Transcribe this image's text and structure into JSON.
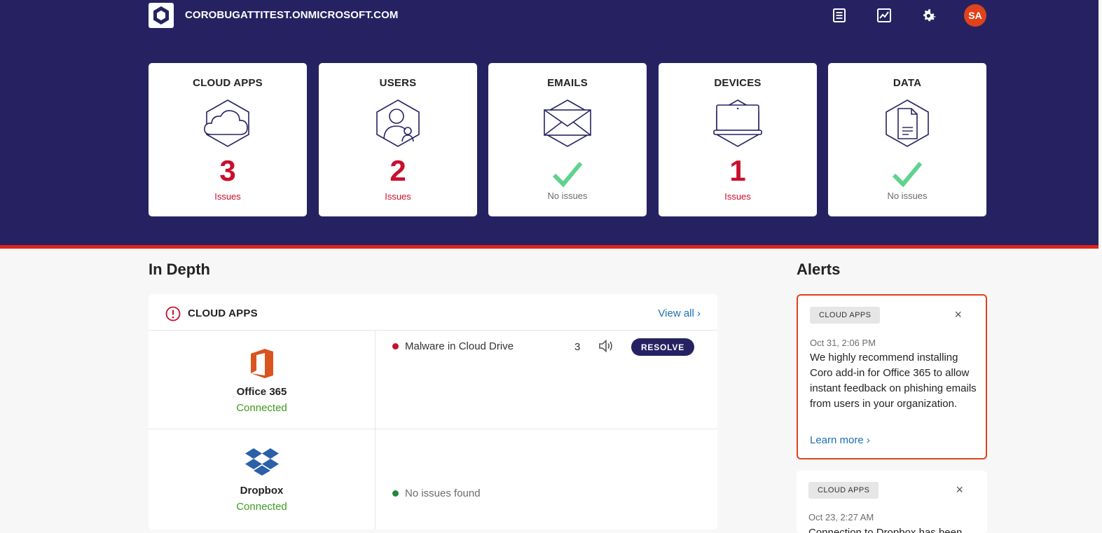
{
  "header": {
    "tenant": "COROBUGATTITEST.ONMICROSOFT.COM",
    "icons": [
      "activity-log-icon",
      "reports-chart-icon",
      "settings-gear-icon"
    ],
    "avatar_initials": "SA"
  },
  "summary_cards": [
    {
      "title": "CLOUD APPS",
      "icon": "cloud-icon",
      "count": "3",
      "status": "Issues"
    },
    {
      "title": "USERS",
      "icon": "user-icon",
      "count": "2",
      "status": "Issues"
    },
    {
      "title": "EMAILS",
      "icon": "envelope-icon",
      "count": "",
      "status": "No issues"
    },
    {
      "title": "DEVICES",
      "icon": "laptop-icon",
      "count": "1",
      "status": "Issues"
    },
    {
      "title": "DATA",
      "icon": "document-icon",
      "count": "",
      "status": "No issues"
    }
  ],
  "in_depth": {
    "heading": "In Depth",
    "panel_title": "CLOUD APPS",
    "view_all": "View all ›",
    "rows": [
      {
        "app": "Office 365",
        "status": "Connected",
        "issue": "Malware in Cloud Drive",
        "count": "3",
        "action": "RESOLVE"
      },
      {
        "app": "Dropbox",
        "status": "Connected",
        "issue": "No issues found"
      }
    ]
  },
  "alerts": {
    "heading": "Alerts",
    "items": [
      {
        "tag": "CLOUD APPS",
        "time": "Oct 31, 2:06 PM",
        "text": "We highly recommend installing Coro add-in for Office 365 to allow instant feedback on phishing emails from users in your organization.",
        "link": "Learn more ›"
      },
      {
        "tag": "CLOUD APPS",
        "time": "Oct 23, 2:27 AM",
        "text": "Connection to Dropbox has been"
      }
    ]
  },
  "colors": {
    "navy": "#262262",
    "issue_red": "#c8102e",
    "ok_green": "#3e9a1c",
    "accent_orange": "#e0421b",
    "link_blue": "#1d6fb8"
  }
}
